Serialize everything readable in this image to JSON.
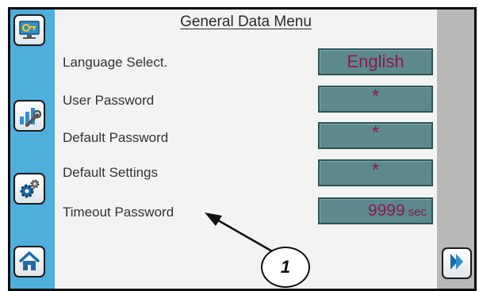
{
  "menu": {
    "title": "General Data Menu"
  },
  "rows": [
    {
      "label": "Language Select.",
      "value": "English"
    },
    {
      "label": "User Password",
      "value": "*"
    },
    {
      "label": "Default Password",
      "value": "*"
    },
    {
      "label": "Default Settings",
      "value": "*"
    },
    {
      "label": "Timeout Password",
      "value": "9999",
      "unit": "sec"
    }
  ],
  "sidebar": {
    "items": [
      {
        "icon": "key-monitor-icon"
      },
      {
        "icon": "tools-chart-icon"
      },
      {
        "icon": "gears-icon"
      },
      {
        "icon": "home-icon"
      }
    ]
  },
  "navigation": {
    "next_icon": "double-chevron-right-icon"
  },
  "callout": {
    "number": "1"
  },
  "colors": {
    "left_bar": "#4faedc",
    "right_bar": "#b8b8b8",
    "field_bg": "#5c8a8c",
    "field_text": "#8c1a4a"
  }
}
